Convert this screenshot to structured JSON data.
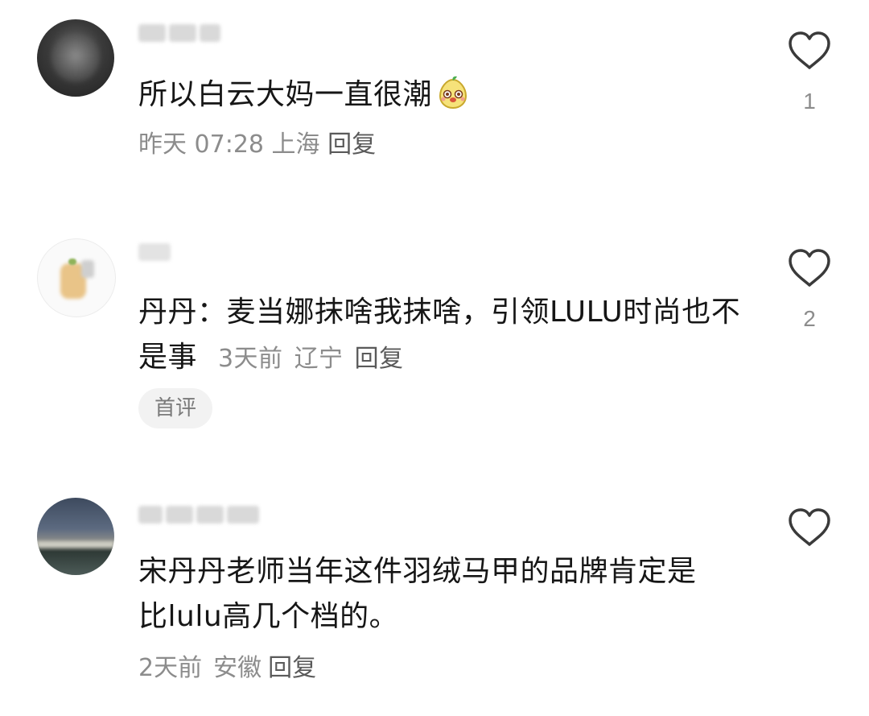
{
  "comments": [
    {
      "text": "所以白云大妈一直很潮",
      "emoji": "pear-face-emoji",
      "time": "昨天 07:28",
      "location": "上海",
      "reply": "回复",
      "likes": "1"
    },
    {
      "text": "丹丹：麦当娜抹啥我抹啥，引领LULU时尚也不是事",
      "time": "3天前",
      "location": "辽宁",
      "reply": "回复",
      "likes": "2",
      "badge": "首评"
    },
    {
      "text": "宋丹丹老师当年这件羽绒马甲的品牌肯定是比lulu高几个档的。",
      "time": "2天前",
      "location": "安徽",
      "reply": "回复",
      "likes": ""
    }
  ],
  "icons": {
    "like": "heart-outline-icon"
  },
  "colors": {
    "meta": "#8c8c8c",
    "text": "#161616",
    "badge_bg": "#f2f2f2"
  }
}
